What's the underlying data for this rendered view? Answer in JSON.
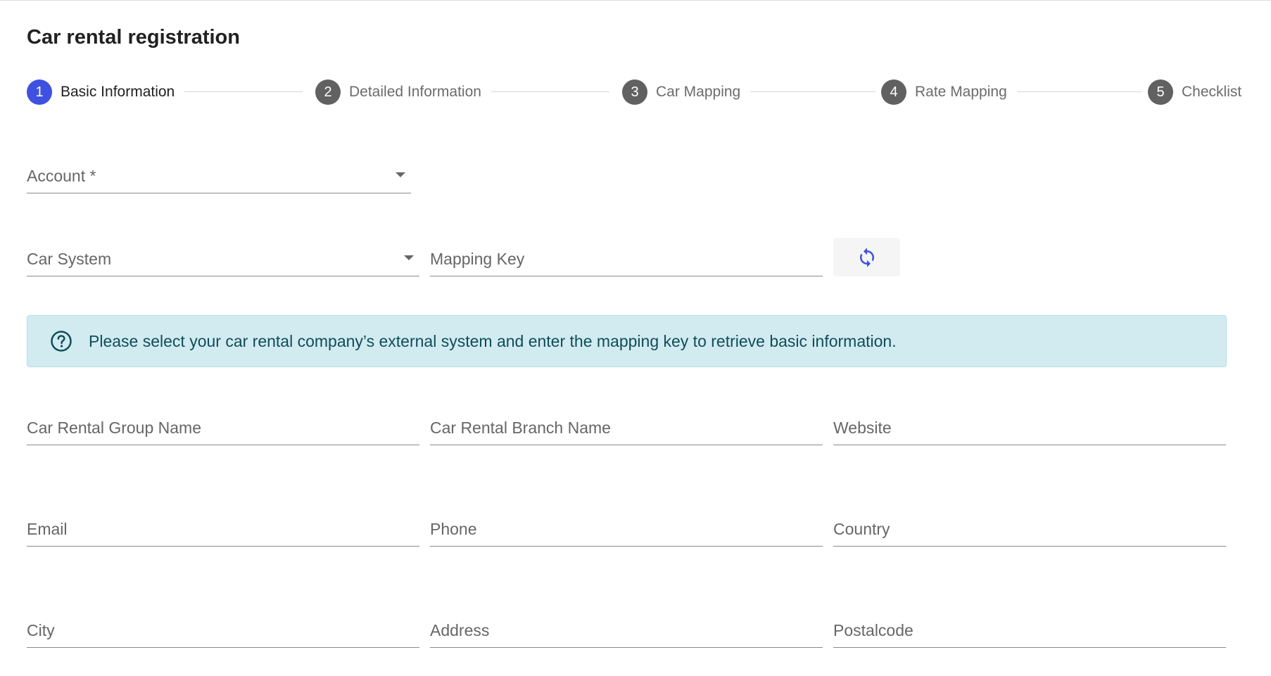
{
  "page": {
    "title": "Car rental registration"
  },
  "stepper": {
    "steps": [
      {
        "number": "1",
        "label": "Basic Information"
      },
      {
        "number": "2",
        "label": "Detailed Information"
      },
      {
        "number": "3",
        "label": "Car Mapping"
      },
      {
        "number": "4",
        "label": "Rate Mapping"
      },
      {
        "number": "5",
        "label": "Checklist"
      }
    ],
    "active_step": "1"
  },
  "form": {
    "account": {
      "label": "Account *",
      "value": ""
    },
    "car_system": {
      "label": "Car System",
      "value": ""
    },
    "mapping_key": {
      "label": "Mapping Key",
      "value": ""
    },
    "refresh_button": {
      "icon": "refresh-icon"
    },
    "info_banner": {
      "icon": "help-circle-icon",
      "text": "Please select your car rental company’s external system and enter the mapping key to retrieve basic information."
    },
    "group_name": {
      "label": "Car Rental Group Name",
      "value": ""
    },
    "branch_name": {
      "label": "Car Rental Branch Name",
      "value": ""
    },
    "website": {
      "label": "Website",
      "value": ""
    },
    "email": {
      "label": "Email",
      "value": ""
    },
    "phone": {
      "label": "Phone",
      "value": ""
    },
    "country": {
      "label": "Country",
      "value": ""
    },
    "city": {
      "label": "City",
      "value": ""
    },
    "address": {
      "label": "Address",
      "value": ""
    },
    "postalcode": {
      "label": "Postalcode",
      "value": ""
    }
  },
  "colors": {
    "primary": "#3f51e0",
    "step_inactive": "#616161",
    "info_background": "#d2ebf0",
    "info_text": "#0f4d5a"
  }
}
